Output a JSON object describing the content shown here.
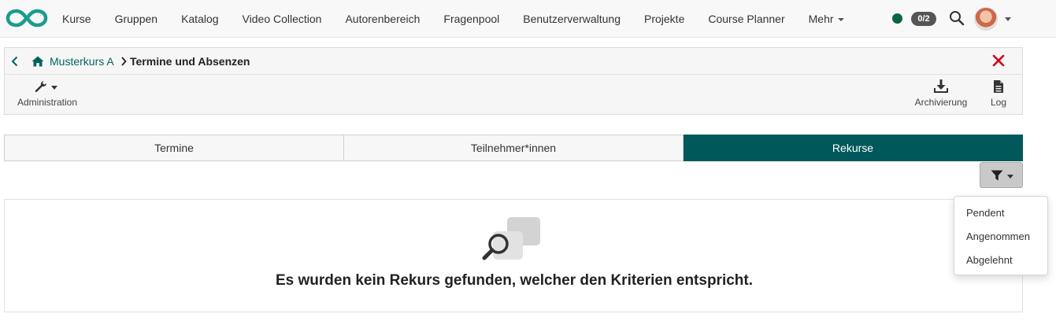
{
  "nav": {
    "items": [
      {
        "label": "Kurse"
      },
      {
        "label": "Gruppen"
      },
      {
        "label": "Katalog"
      },
      {
        "label": "Video Collection"
      },
      {
        "label": "Autorenbereich"
      },
      {
        "label": "Fragenpool"
      },
      {
        "label": "Benutzerverwaltung"
      },
      {
        "label": "Projekte"
      },
      {
        "label": "Course Planner"
      },
      {
        "label": "Mehr"
      }
    ],
    "badge": "0/2",
    "status_color": "#0a6640"
  },
  "breadcrumb": {
    "link": "Musterkurs A",
    "current": "Termine und Absenzen"
  },
  "toolbar": {
    "admin_label": "Administration",
    "archive_label": "Archivierung",
    "log_label": "Log"
  },
  "tabs": [
    {
      "label": "Termine"
    },
    {
      "label": "Teilnehmer*innen"
    },
    {
      "label": "Rekurse",
      "active": true
    }
  ],
  "empty_state": {
    "message": "Es wurden kein Rekurs gefunden, welcher den Kriterien entspricht."
  },
  "filter_menu": {
    "options": [
      {
        "label": "Pendent"
      },
      {
        "label": "Angenommen"
      },
      {
        "label": "Abgelehnt"
      }
    ]
  },
  "colors": {
    "accent": "#00585a",
    "link": "#00645d",
    "close": "#d0021b"
  },
  "icons": [
    "logo-icon",
    "search-icon",
    "home-icon",
    "back-icon",
    "wrench-icon",
    "download-icon",
    "file-icon",
    "close-icon",
    "filter-icon",
    "magnifier-icon"
  ]
}
